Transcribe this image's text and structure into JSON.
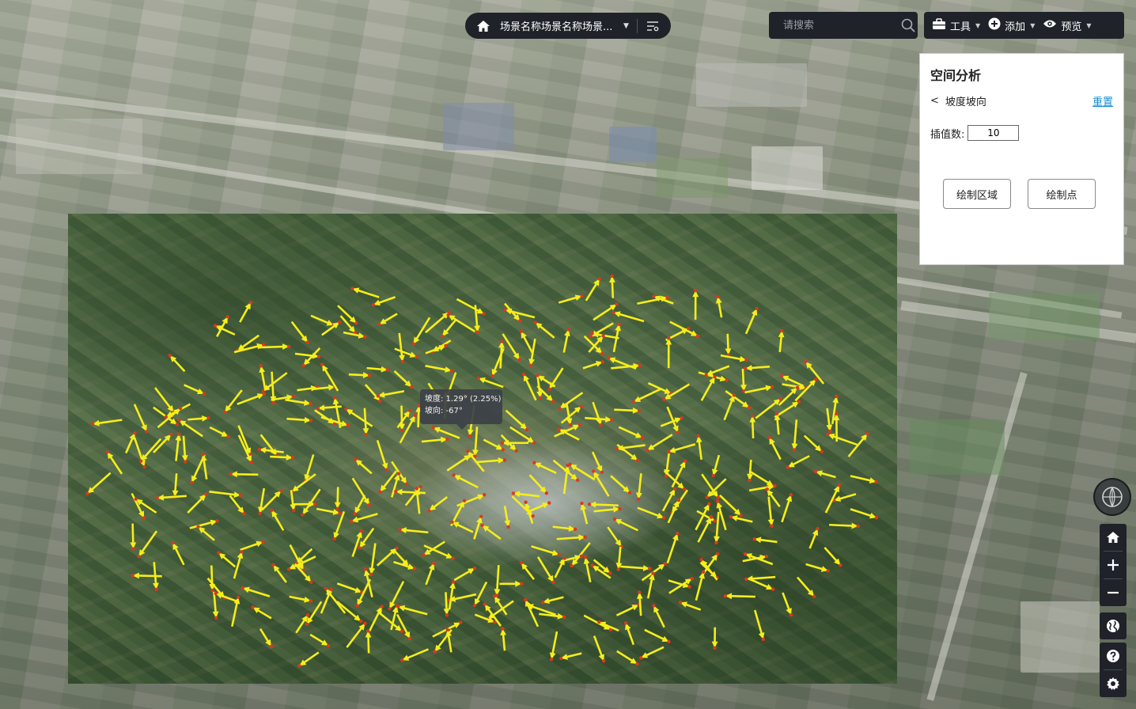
{
  "scene": {
    "name": "场景名称场景名称场景...",
    "home_icon": "home-icon",
    "filter_icon": "filter-icon"
  },
  "search": {
    "placeholder": "请搜索"
  },
  "toolbar": {
    "tools_label": "工具",
    "add_label": "添加",
    "preview_label": "预览"
  },
  "panel": {
    "title": "空间分析",
    "back_label": "坡度坡向",
    "reset_label": "重置",
    "interp_label": "插值数:",
    "interp_value": "10",
    "draw_area_label": "绘制区域",
    "draw_point_label": "绘制点"
  },
  "tooltip": {
    "slope": "坡度: 1.29° (2.25%)",
    "aspect": "坡向: -67°"
  },
  "nav": {
    "compass_icon": "compass-icon",
    "home_icon": "home-icon",
    "zoom_in_icon": "zoom-in-icon",
    "zoom_out_icon": "zoom-out-icon",
    "globe_icon": "globe-icon",
    "help_icon": "help-icon",
    "settings_icon": "settings-icon"
  },
  "colors": {
    "arrow": "#f5ee1a",
    "arrow_tail": "#d83a1e",
    "dark_ui": "#1f2229",
    "link": "#1a8fd1"
  }
}
